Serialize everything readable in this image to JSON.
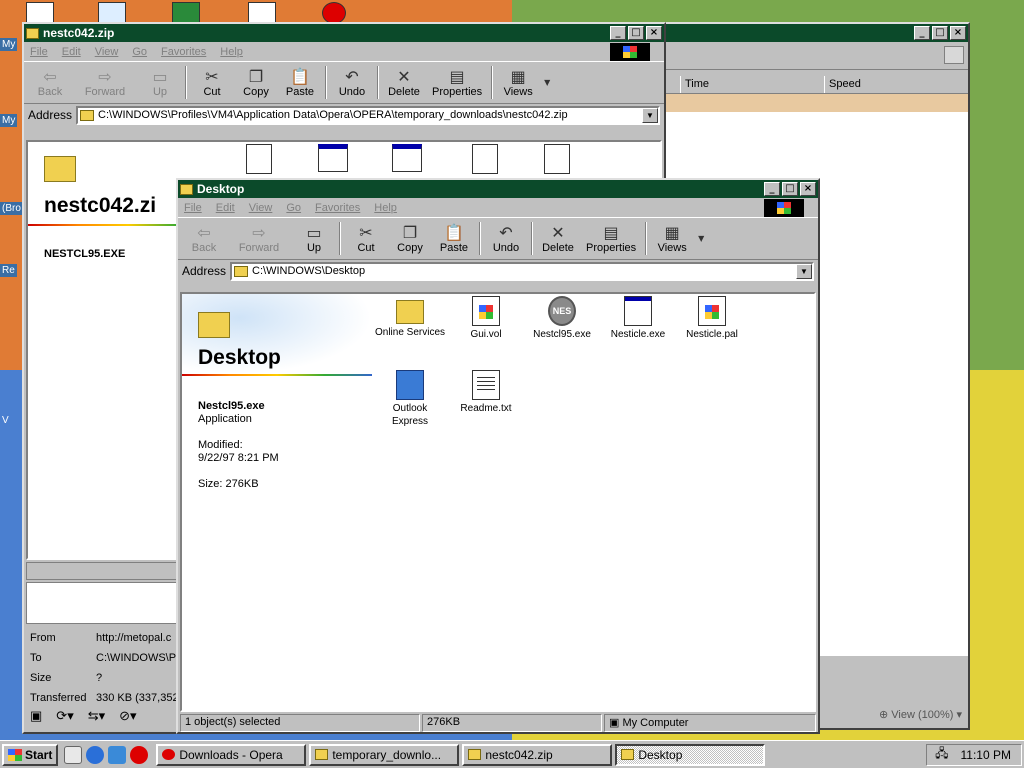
{
  "desktop": {
    "partial_labels": [
      "My",
      "My",
      "(Bro",
      "Re",
      "V"
    ]
  },
  "download_window": {
    "columns": [
      "Time",
      "Speed"
    ],
    "details": [
      {
        "label": "From",
        "value": "http://metopal.c"
      },
      {
        "label": "To",
        "value": "C:\\WINDOWS\\Pr"
      },
      {
        "label": "Size",
        "value": "?"
      },
      {
        "label": "Transferred",
        "value": "330 KB (337,352"
      }
    ],
    "zoom": "View (100%)"
  },
  "zip_window": {
    "title": "nestc042.zip",
    "menu": [
      "File",
      "Edit",
      "View",
      "Go",
      "Favorites",
      "Help"
    ],
    "toolbar": [
      "Back",
      "Forward",
      "Up",
      "Cut",
      "Copy",
      "Paste",
      "Undo",
      "Delete",
      "Properties",
      "Views"
    ],
    "address_label": "Address",
    "address": "C:\\WINDOWS\\Profiles\\VM4\\Application Data\\Opera\\OPERA\\temporary_downloads\\nestc042.zip",
    "heading": "nestc042.zi",
    "selected_file": "NESTCL95.EXE"
  },
  "desktop_window": {
    "title": "Desktop",
    "menu": [
      "File",
      "Edit",
      "View",
      "Go",
      "Favorites",
      "Help"
    ],
    "toolbar": [
      "Back",
      "Forward",
      "Up",
      "Cut",
      "Copy",
      "Paste",
      "Undo",
      "Delete",
      "Properties",
      "Views"
    ],
    "address_label": "Address",
    "address": "C:\\WINDOWS\\Desktop",
    "heading": "Desktop",
    "info": {
      "name": "Nestcl95.exe",
      "type": "Application",
      "modified_label": "Modified:",
      "modified": "9/22/97 8:21 PM",
      "size": "Size: 276KB"
    },
    "files": [
      {
        "name": "Online Services",
        "icon": "folder-icon"
      },
      {
        "name": "Gui.vol",
        "icon": "vol-file-icon"
      },
      {
        "name": "Nestcl95.exe",
        "icon": "nes-app-icon"
      },
      {
        "name": "Nesticle.exe",
        "icon": "app-window-icon"
      },
      {
        "name": "Nesticle.pal",
        "icon": "vol-file-icon"
      },
      {
        "name": "Outlook Express",
        "icon": "outlook-express-icon"
      },
      {
        "name": "Readme.txt",
        "icon": "text-document-icon"
      }
    ],
    "status": {
      "selection": "1 object(s) selected",
      "size": "276KB",
      "location": "My Computer"
    }
  },
  "taskbar": {
    "start": "Start",
    "tasks": [
      "Downloads - Opera",
      "temporary_downlo...",
      "nestc042.zip",
      "Desktop"
    ],
    "clock": "11:10 PM"
  }
}
